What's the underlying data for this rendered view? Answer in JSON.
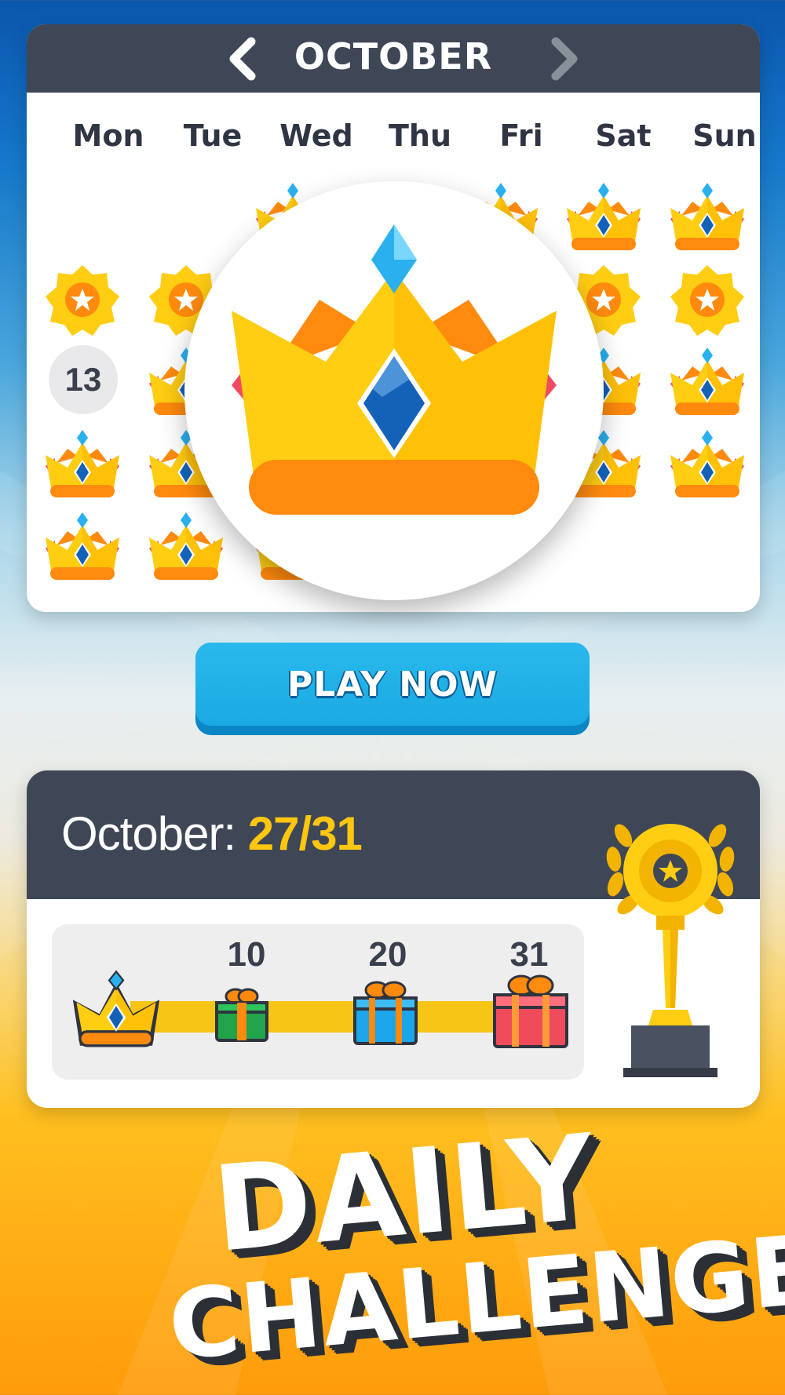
{
  "calendar": {
    "month": "OCTOBER",
    "weekdays": [
      "Mon",
      "Tue",
      "Wed",
      "Thu",
      "Fri",
      "Sat",
      "Sun"
    ],
    "today_label": "13",
    "nav_prev_icon": "chevron-left-icon",
    "nav_next_icon": "chevron-right-icon",
    "cell_icons": [
      "crown-icon",
      "star-badge-icon"
    ],
    "featured_icon": "crown-icon"
  },
  "play_button": {
    "label": "PLAY NOW"
  },
  "progress": {
    "month_label": "October:",
    "count": "27/31",
    "completed": 27,
    "total": 31,
    "milestones": [
      {
        "label": "10",
        "icon": "gift-icon",
        "color": "#21a34a"
      },
      {
        "label": "20",
        "icon": "gift-icon",
        "color": "#1da5ea"
      },
      {
        "label": "31",
        "icon": "gift-icon",
        "color": "#f04b5a"
      }
    ],
    "trophy_icon": "trophy-icon"
  },
  "title": {
    "line1": "DAILY",
    "line2": "CHALLENGE"
  },
  "colors": {
    "header_dark": "#3f4756",
    "accent_yellow": "#ffc60f",
    "button_blue": "#1aa9e2"
  }
}
